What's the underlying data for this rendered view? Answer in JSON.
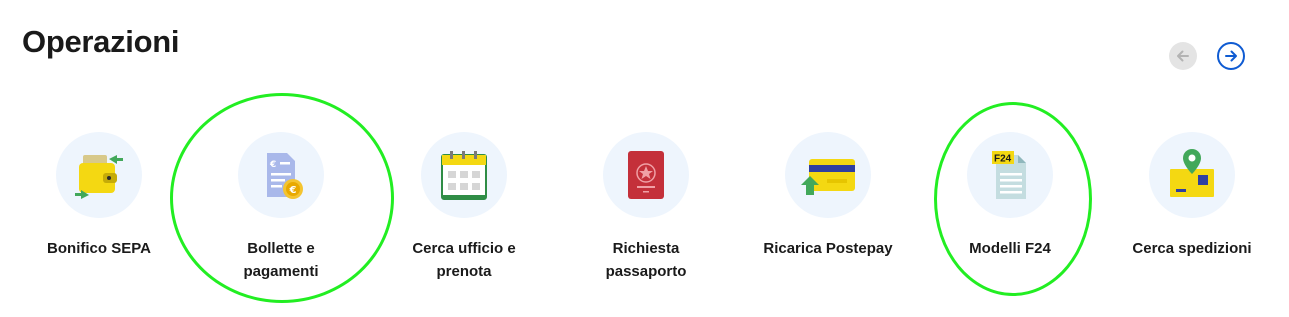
{
  "header": {
    "title": "Operazioni"
  },
  "carousel": {
    "prev_icon": "arrow-left-icon",
    "next_icon": "arrow-right-icon",
    "prev_disabled": true
  },
  "operations": [
    {
      "label": "Bonifico SEPA",
      "icon": "wallet-transfer-icon"
    },
    {
      "label": "Bollette e pagamenti",
      "icon": "bill-coin-icon"
    },
    {
      "label": "Cerca ufficio e prenota",
      "icon": "calendar-icon"
    },
    {
      "label": "Richiesta passaporto",
      "icon": "passport-icon"
    },
    {
      "label": "Ricarica Postepay",
      "icon": "card-topup-icon"
    },
    {
      "label": "Modelli F24",
      "icon": "f24-document-icon",
      "icon_text": "F24"
    },
    {
      "label": "Cerca spedizioni",
      "icon": "package-location-icon"
    }
  ],
  "colors": {
    "accent_blue": "#0f5bd2",
    "icon_bg": "#eef5fd",
    "brand_yellow": "#f4d812",
    "highlight_green": "#22ee22"
  }
}
